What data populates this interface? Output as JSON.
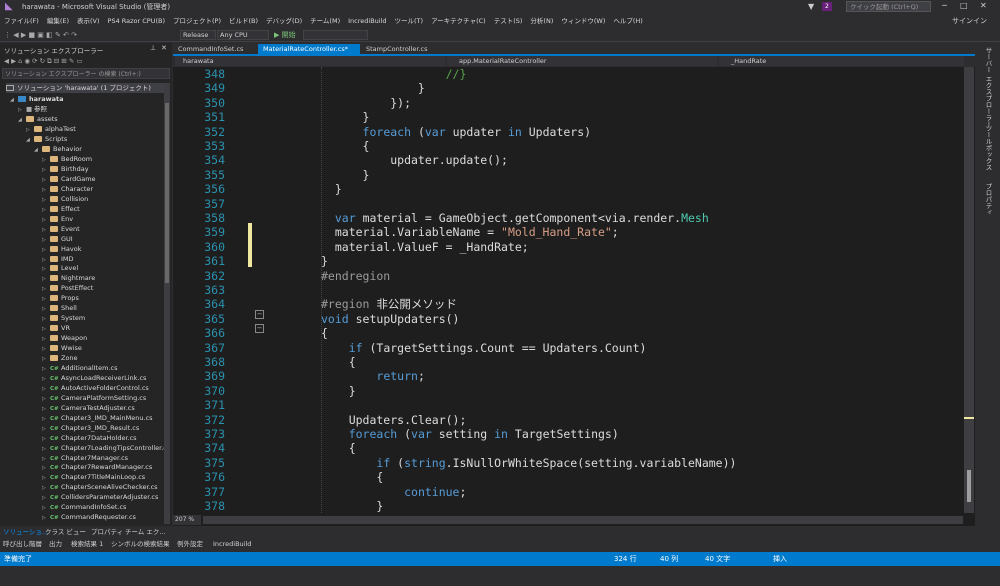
{
  "window": {
    "title": "harawata - Microsoft Visual Studio (管理者)",
    "notifications": "2",
    "quick_launch": "クイック起動 (Ctrl+Q)",
    "signin": "サインイン"
  },
  "menu": [
    "ファイル(F)",
    "編集(E)",
    "表示(V)",
    "PS4 Razor CPU(B)",
    "プロジェクト(P)",
    "ビルド(B)",
    "デバッグ(D)",
    "チーム(M)",
    "IncrediBuild",
    "ツール(T)",
    "アーキテクチャ(C)",
    "テスト(S)",
    "分析(N)",
    "ウィンドウ(W)",
    "ヘルプ(H)"
  ],
  "toolbar": {
    "config": "Release",
    "platform": "Any CPU",
    "start": "▶ 開始"
  },
  "solution_explorer": {
    "title": "ソリューション エクスプローラー",
    "search_placeholder": "ソリューション エクスプローラー の検索 (Ctrl+:)",
    "solution": "ソリューション 'harawata' (1 プロジェクト)",
    "project": "harawata",
    "references": "参照",
    "assets": "assets",
    "alphaTest": "alphaTest",
    "scripts": "Scripts",
    "behavior": "Behavior",
    "folders": [
      "BedRoom",
      "Birthday",
      "CardGame",
      "Character",
      "Collision",
      "Effect",
      "Env",
      "Event",
      "GUI",
      "Havok",
      "IMD",
      "Level",
      "Nightmare",
      "PostEffect",
      "Props",
      "Shell",
      "System",
      "VR",
      "Weapon",
      "Wwise",
      "Zone"
    ],
    "files": [
      "AdditionalItem.cs",
      "AsyncLoadReceiverLink.cs",
      "AutoActiveFolderControl.cs",
      "CameraPlatformSetting.cs",
      "CameraTestAdjuster.cs",
      "Chapter3_IMD_MainMenu.cs",
      "Chapter3_IMD_Result.cs",
      "Chapter7DataHolder.cs",
      "Chapter7LoadingTipsController.cs",
      "Chapter7Manager.cs",
      "Chapter7RewardManager.cs",
      "Chapter7TitleMainLoop.cs",
      "ChapterSceneAliveChecker.cs",
      "CollidersParameterAdjuster.cs",
      "CommandInfoSet.cs",
      "CommandRequester.cs"
    ],
    "bottom_tabs": [
      "ソリューショ...",
      "クラス ビュー",
      "プロパティ",
      "チーム エク..."
    ]
  },
  "editor": {
    "tabs": [
      "CommandInfoSet.cs",
      "MaterialRateController.cs*",
      "StampController.cs"
    ],
    "nav": {
      "project": "harawata",
      "class": "app.MaterialRateController",
      "member": "_HandRate"
    },
    "zoom": "207 %",
    "first_line": 348,
    "lines": [
      [
        [
          "",
          "                  "
        ],
        [
          "cm",
          "//}"
        ]
      ],
      [
        [
          "",
          "              }"
        ]
      ],
      [
        [
          "",
          "          });"
        ]
      ],
      [
        [
          "",
          "      }"
        ]
      ],
      [
        [
          "",
          "      "
        ],
        [
          "kw",
          "foreach"
        ],
        [
          "",
          " ("
        ],
        [
          "kw",
          "var"
        ],
        [
          "",
          " updater "
        ],
        [
          "kw",
          "in"
        ],
        [
          "",
          " Updaters)"
        ]
      ],
      [
        [
          "",
          "      {"
        ]
      ],
      [
        [
          "",
          "          updater.update();"
        ]
      ],
      [
        [
          "",
          "      }"
        ]
      ],
      [
        [
          "",
          "  }"
        ]
      ],
      [
        [
          "",
          ""
        ]
      ],
      [
        [
          "",
          "  "
        ],
        [
          "kw",
          "var"
        ],
        [
          "",
          " material = GameObject.getComponent<via.render."
        ],
        [
          "ty",
          "Mesh"
        ],
        [
          ">().Materials[5];"
        ]
      ],
      [
        [
          "",
          "  material.VariableName = "
        ],
        [
          "st",
          "\"Mold_Hand_Rate\""
        ],
        [
          "",
          ";"
        ]
      ],
      [
        [
          "",
          "  material.ValueF = _HandRate;"
        ]
      ],
      [
        [
          "",
          "}"
        ]
      ],
      [
        [
          "pre",
          "#endregion"
        ]
      ],
      [
        [
          "",
          ""
        ]
      ],
      [
        [
          "pre",
          "#region"
        ],
        [
          "",
          " 非公開メソッド"
        ]
      ],
      [
        [
          "kw",
          "void"
        ],
        [
          "",
          " setupUpdaters()"
        ]
      ],
      [
        [
          "",
          "{"
        ]
      ],
      [
        [
          "",
          "    "
        ],
        [
          "kw",
          "if"
        ],
        [
          "",
          " (TargetSettings.Count == Updaters.Count)"
        ]
      ],
      [
        [
          "",
          "    {"
        ]
      ],
      [
        [
          "",
          "        "
        ],
        [
          "kw",
          "return"
        ],
        [
          "",
          ";"
        ]
      ],
      [
        [
          "",
          "    }"
        ]
      ],
      [
        [
          "",
          ""
        ]
      ],
      [
        [
          "",
          "    Updaters.Clear();"
        ]
      ],
      [
        [
          "",
          "    "
        ],
        [
          "kw",
          "foreach"
        ],
        [
          "",
          " ("
        ],
        [
          "kw",
          "var"
        ],
        [
          "",
          " setting "
        ],
        [
          "kw",
          "in"
        ],
        [
          "",
          " TargetSettings)"
        ]
      ],
      [
        [
          "",
          "    {"
        ]
      ],
      [
        [
          "",
          "        "
        ],
        [
          "kw",
          "if"
        ],
        [
          "",
          " ("
        ],
        [
          "kw",
          "string"
        ],
        [
          "",
          ".IsNullOrWhiteSpace(setting.variableName))"
        ]
      ],
      [
        [
          "",
          "        {"
        ]
      ],
      [
        [
          "",
          "            "
        ],
        [
          "kw",
          "continue"
        ],
        [
          "",
          ";"
        ]
      ],
      [
        [
          "",
          "        }"
        ]
      ]
    ]
  },
  "right_panel": [
    "サーバー エクスプローラー",
    "ツールボックス",
    "プロパティ"
  ],
  "output_tabs": [
    "呼び出し階層",
    "出力",
    "検索結果 1",
    "シンボルの検索結果",
    "例外設定",
    "IncrediBuild"
  ],
  "status": {
    "ready": "準備完了",
    "line": "324 行",
    "col": "40 列",
    "char": "40 文字",
    "mode": "挿入"
  }
}
